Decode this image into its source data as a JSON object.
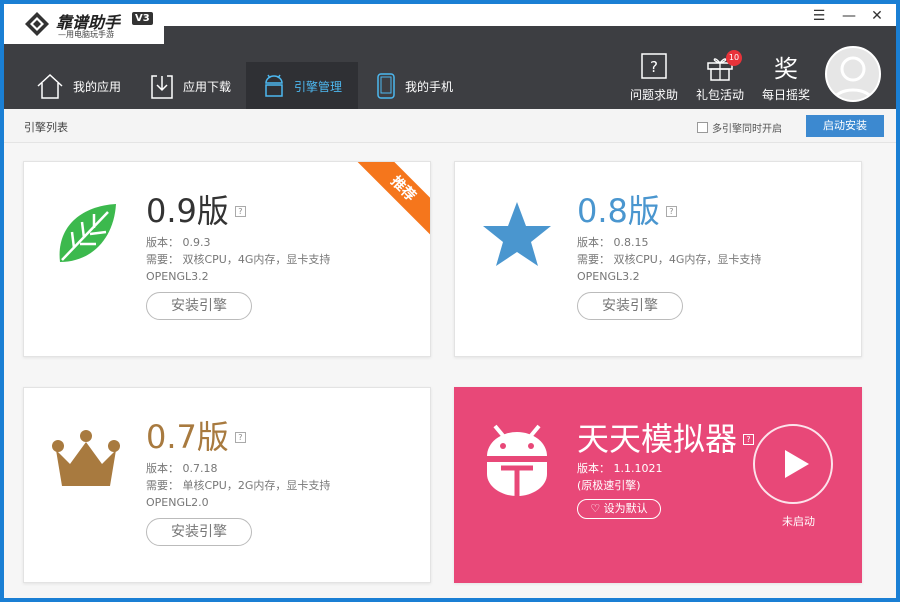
{
  "app": {
    "title": "靠谱助手",
    "subtitle": "—用电脑玩手游",
    "version": "V3"
  },
  "window_controls": {
    "menu": "☰",
    "minimize": "—",
    "close": "✕"
  },
  "nav": [
    {
      "label": "我的应用",
      "icon": "home-icon",
      "active": false
    },
    {
      "label": "应用下载",
      "icon": "download-icon",
      "active": false
    },
    {
      "label": "引擎管理",
      "icon": "android-icon",
      "active": true
    },
    {
      "label": "我的手机",
      "icon": "phone-icon",
      "active": false
    }
  ],
  "tools": [
    {
      "label": "问题求助",
      "icon": "help-icon"
    },
    {
      "label": "礼包活动",
      "icon": "gift-icon",
      "badge": "10"
    },
    {
      "label": "每日摇奖",
      "icon": "lottery-icon"
    }
  ],
  "subbar": {
    "title": "引擎列表",
    "multi_label": "多引擎同时开启",
    "start_button": "启动安装"
  },
  "engines": [
    {
      "name": "0.9版",
      "color": "#333333",
      "version_line": "版本： 0.9.3",
      "req_line": "需要： 双核CPU，4G内存，显卡支持",
      "req_line2": "OPENGL3.2",
      "button": "安装引擎",
      "ribbon": "推荐",
      "icon": "leaf-icon"
    },
    {
      "name": "0.8版",
      "color": "#4a96cf",
      "version_line": "版本： 0.8.15",
      "req_line": "需要： 双核CPU，4G内存，显卡支持",
      "req_line2": "OPENGL3.2",
      "button": "安装引擎",
      "icon": "star-icon"
    },
    {
      "name": "0.7版",
      "color": "#a87a3f",
      "version_line": "版本： 0.7.18",
      "req_line": "需要： 单核CPU，2G内存，显卡支持",
      "req_line2": "OPENGL2.0",
      "button": "安装引擎",
      "icon": "crown-icon"
    },
    {
      "name": "天天模拟器",
      "color": "#ffffff",
      "version_line": "版本： 1.1.1021",
      "req_line": "(原极速引擎)",
      "button": "设为默认",
      "state": "未启动",
      "icon": "android-bot-icon"
    }
  ]
}
